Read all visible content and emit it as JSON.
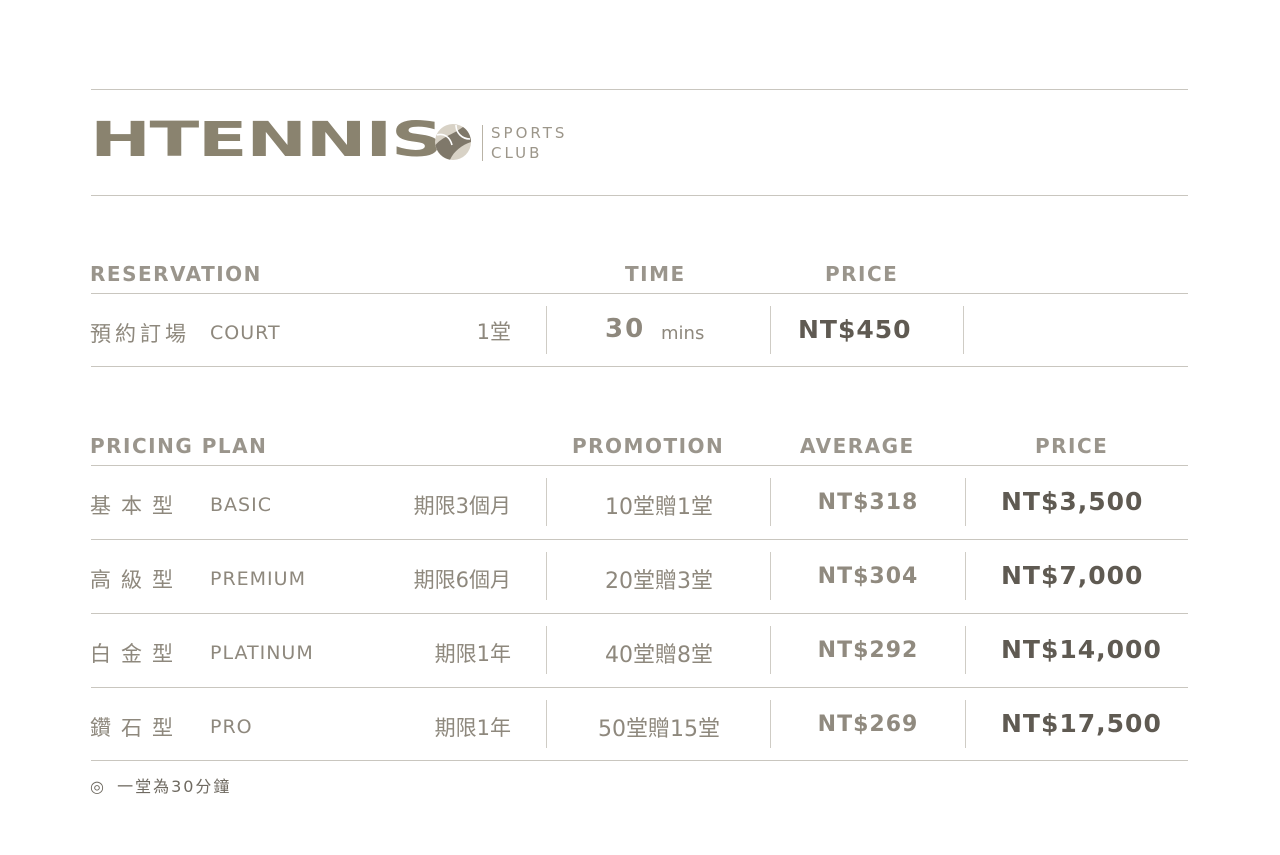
{
  "brand": {
    "name": "HTENNIS",
    "sub_line1": "SPORTS",
    "sub_line2": "CLUB",
    "colors": {
      "primary": "#8a836f",
      "ball_light": "#d8d2c6",
      "ball_dark": "#7f786a"
    }
  },
  "reservation": {
    "header": {
      "title": "RESERVATION",
      "time": "TIME",
      "price": "PRICE"
    },
    "row": {
      "name_cn": "預約訂場",
      "name_en": "COURT",
      "unit": "1堂",
      "time_value": "30",
      "time_unit": "mins",
      "price": "NT$450"
    }
  },
  "pricing": {
    "header": {
      "title": "PRICING PLAN",
      "promotion": "PROMOTION",
      "average": "AVERAGE",
      "price": "PRICE"
    },
    "plans": [
      {
        "name_cn": "基本型",
        "name_en": "BASIC",
        "period": "期限3個月",
        "promotion": "10堂贈1堂",
        "average": "NT$318",
        "price": "NT$3,500"
      },
      {
        "name_cn": "高級型",
        "name_en": "PREMIUM",
        "period": "期限6個月",
        "promotion": "20堂贈3堂",
        "average": "NT$304",
        "price": "NT$7,000"
      },
      {
        "name_cn": "白金型",
        "name_en": "PLATINUM",
        "period": "期限1年",
        "promotion": "40堂贈8堂",
        "average": "NT$292",
        "price": "NT$14,000"
      },
      {
        "name_cn": "鑽石型",
        "name_en": "PRO",
        "period": "期限1年",
        "promotion": "50堂贈15堂",
        "average": "NT$269",
        "price": "NT$17,500"
      }
    ]
  },
  "footnote": {
    "symbol": "◎",
    "text": "一堂為30分鐘"
  }
}
